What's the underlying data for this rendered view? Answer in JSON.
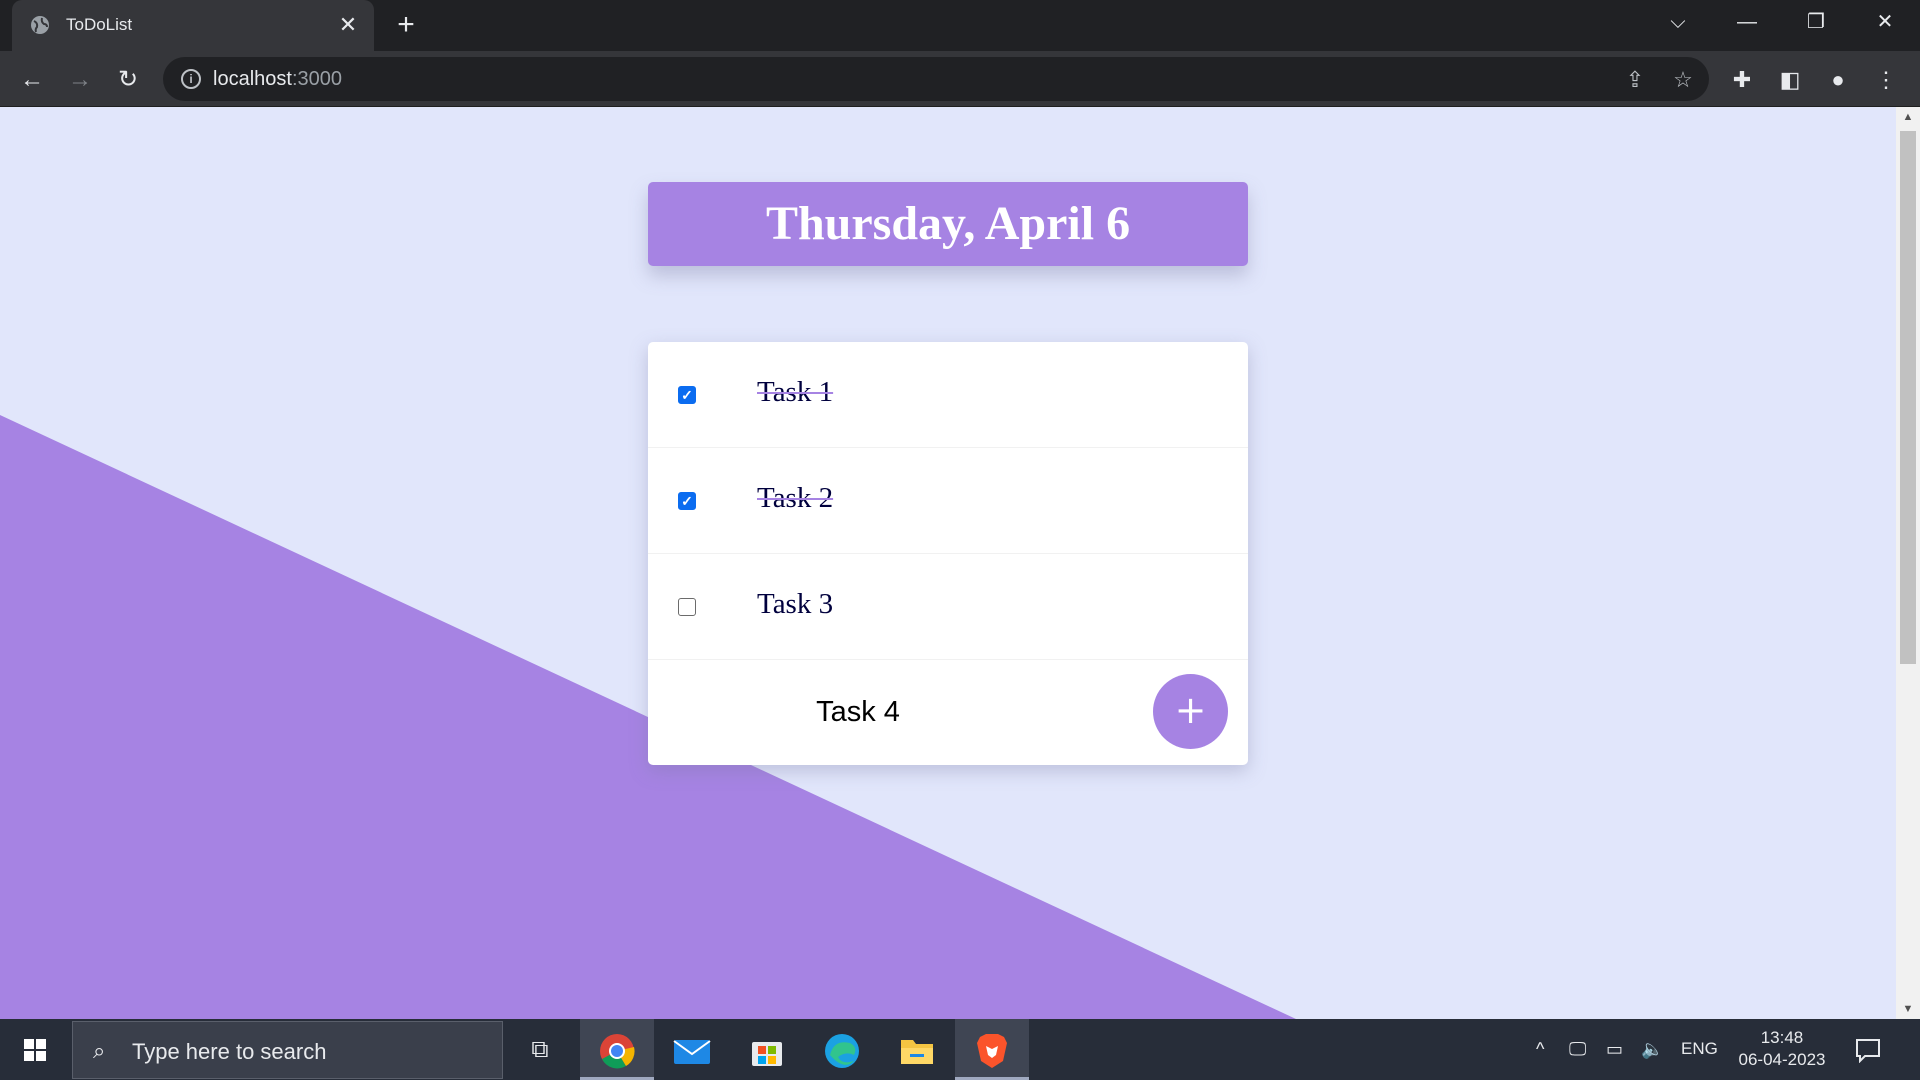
{
  "browser": {
    "tab_title": "ToDoList",
    "url_host": "localhost",
    "url_port": ":3000"
  },
  "page": {
    "heading": "Thursday, April 6",
    "tasks": [
      {
        "label": "Task 1",
        "checked": true
      },
      {
        "label": "Task 2",
        "checked": true
      },
      {
        "label": "Task 3",
        "checked": false
      }
    ],
    "new_item_value": "Task 4",
    "add_button_label": "+"
  },
  "taskbar": {
    "search_placeholder": "Type here to search",
    "language": "ENG",
    "time": "13:48",
    "date": "06-04-2023"
  },
  "colors": {
    "accent": "#a683e3",
    "background": "#e1e6fb",
    "task_text": "#00003d",
    "checkbox": "#0b6cf0"
  }
}
